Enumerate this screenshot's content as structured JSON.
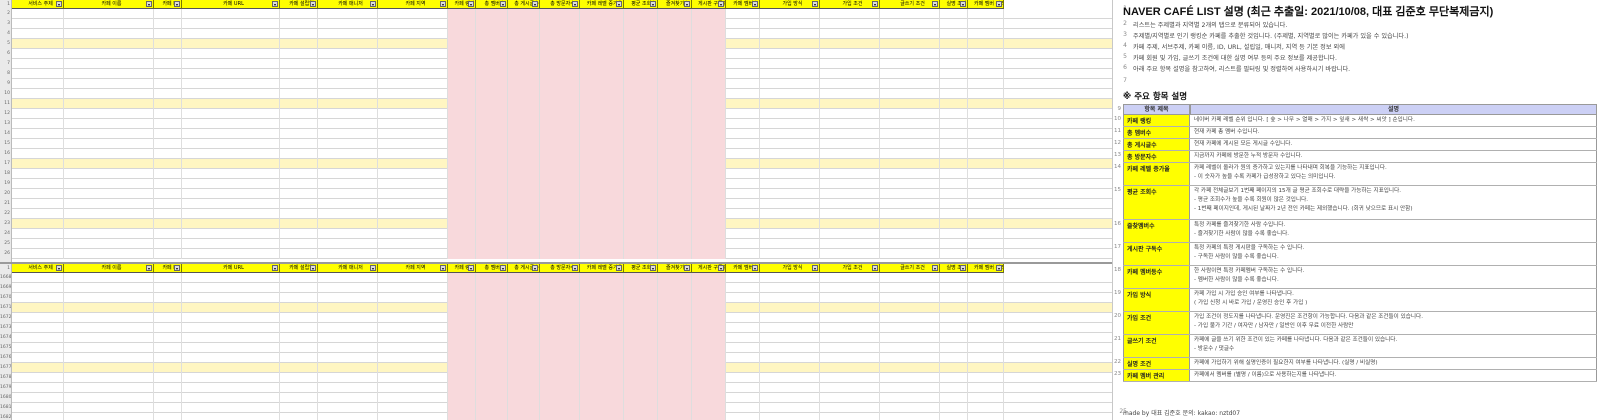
{
  "header_columns": [
    "서비스 주제",
    "카페 이름",
    "카페 ID",
    "카페 URL",
    "카페 설립일",
    "카페 매니저",
    "카페 지역",
    "카페 랭킹",
    "총 멤버수",
    "총 게시글수",
    "총 방문자수",
    "카페 레벨 증가율",
    "평균 조회수",
    "즐겨찾기수",
    "게시판 구독수",
    "카페 멤버수",
    "가입 방식",
    "가입 조건",
    "글쓰기 조건",
    "실명 조건",
    "카페 멤버 관리"
  ],
  "top_row_numbers": [
    "1",
    "2",
    "3",
    "4",
    "5",
    "6",
    "7",
    "8",
    "9",
    "10",
    "11",
    "12",
    "13",
    "14",
    "15",
    "16",
    "17",
    "18",
    "19",
    "20",
    "21",
    "22",
    "23",
    "24",
    "25",
    "26"
  ],
  "bottom_row_numbers": [
    "1",
    "1668",
    "1669",
    "1670",
    "1671",
    "1672",
    "1673",
    "1674",
    "1675",
    "1676",
    "1677",
    "1678",
    "1679",
    "1680",
    "1681",
    "1682"
  ],
  "panel": {
    "title": "NAVER CAFÉ LIST 설명 (최근 추출일: 2021/10/08, 대표 김준호 무단복제금지)",
    "intro_numbers": [
      "2",
      "3",
      "4",
      "5",
      "6",
      "7"
    ],
    "intro": [
      "리스트는 주제별과 지역별 2개의 탭으로 분류되어 있습니다.",
      "주제별/지역별로 인기 랭킹순 카페를 추출한 것입니다. (주제별, 지역별로 많이는 카페가 있을 수 있습니다.)",
      "카페 주제, 서브주제, 카페 이름, ID, URL, 설립일, 매니저, 지역 등 기본 정보 외에",
      "카페 회원 및 가입, 글쓰기 조건에 대한 실명 여부 등의 주요 정보를 제공합니다.",
      "아래 주요 항목 설명을 참고하여, 리스트를 필터링 및 정렬하여 사용하시기 바랍니다.",
      ""
    ],
    "section_number": "8",
    "section_title": "※ 주요 항목 설명",
    "table_header_number": "9",
    "table_header": [
      "항목 제목",
      "설명"
    ],
    "rows": [
      {
        "num": "10",
        "key": "카페 랭킹",
        "desc": [
          "네이버 카페 레벨 순위 입니다. [ 숲 > 나무 > 열매 > 가지 > 잎새 > 새싹 > 씨앗 ] 순입니다."
        ],
        "h": 10
      },
      {
        "num": "11",
        "key": "총 멤버수",
        "desc": [
          "현재 카페 총 멤버 수입니다."
        ],
        "h": 10
      },
      {
        "num": "12",
        "key": "총 게시글수",
        "desc": [
          "현재 카페에 게시된 모든 게시글 수입니다."
        ],
        "h": 10
      },
      {
        "num": "13",
        "key": "총 방문자수",
        "desc": [
          "지금까지 카페에 방문한 누적 방문자 수입니다."
        ],
        "h": 10
      },
      {
        "num": "14",
        "key": "카페 레벨 증가율",
        "desc": [
          "카페 레벨이 올라가 원의 증가하고 있는지를 나타내며 회복을 기능하는 지표입니다.",
          "- 이 숫자가 높을 수록 카페가 급성장하고 있다는 의미입니다."
        ],
        "h": 22
      },
      {
        "num": "15",
        "key": "평균 조회수",
        "desc": [
          "각 카페 전체글보기 1번째 페이지의 15개 글 평균 조회수로 대략을 가능하는 지표입니다.",
          "- 평균 조회수가 높을 수록 회원이 많은 것입니다.",
          "- 1번째 페이지인데, 게시된 날짜가 2년 전인 카페는 제외했습니다. (회귀 낮으므로 표시 안함)"
        ],
        "h": 33
      },
      {
        "num": "16",
        "key": "즐찾멤버수",
        "desc": [
          "특정 카페를 즐겨찾기한 사람 수입니다.",
          "- 즐겨찾기한 사람이 많을 수록 좋습니다."
        ],
        "h": 22
      },
      {
        "num": "17",
        "key": "게시판 구독수",
        "desc": [
          "특정 카페의 특정 게시판을 구독하는 수 입니다.",
          "- 구독한 사람이 많을 수록 좋습니다."
        ],
        "h": 22
      },
      {
        "num": "18",
        "key": "카페 멤버등수",
        "desc": [
          "한 사람이면 특정 카페멤버 구독하는 수 입니다.",
          "- 멤버한 사람이 많을 수록 좋습니다."
        ],
        "h": 22
      },
      {
        "num": "19",
        "key": "가입 방식",
        "desc": [
          "카페 가입 시 가입 승인 여부를 나타냅니다.",
          "( 가입 신청 시 바로 가입 / 운영진 승인 후 가입 )"
        ],
        "h": 22
      },
      {
        "num": "20",
        "key": "가입 조건",
        "desc": [
          "가입 조건이 정도지를 나타냅니다. 운영진은 조건항이 가능합니다. 다음과 같은 조건들이 있습니다.",
          "- 가입 불가 기간 / 여자만 / 남자만 / 일반인 이후 무료 이전한 사람만"
        ],
        "h": 22
      },
      {
        "num": "21",
        "key": "글쓰기 조건",
        "desc": [
          "카페에 글을 쓰기 위한 조건이 있는 카페를 나타냅니다. 다음과 같은 조건들이 있습니다.",
          "- 방문수 / 댓글수"
        ],
        "h": 22
      },
      {
        "num": "22",
        "key": "실명 조건",
        "desc": [
          "카페에 가입하기 위해 실명인증이 필요한지 여부를 나타냅니다. (실명 / 비실명)"
        ],
        "h": 10
      },
      {
        "num": "23",
        "key": "카페 멤버 관리",
        "desc": [
          "카페에서 멤버를 (별명 / 이름)으로 사용하는지를 나타냅니다."
        ],
        "h": 10
      }
    ],
    "footer_number": "25",
    "footer": "made by 대표 김준호    문의: kakao: nztd07"
  },
  "colors": {
    "header_yellow": "#ffff00",
    "pink_cols": "#f8d9dc",
    "table_header_blue": "#ccd0f5",
    "red_highlight": "#e00000"
  }
}
